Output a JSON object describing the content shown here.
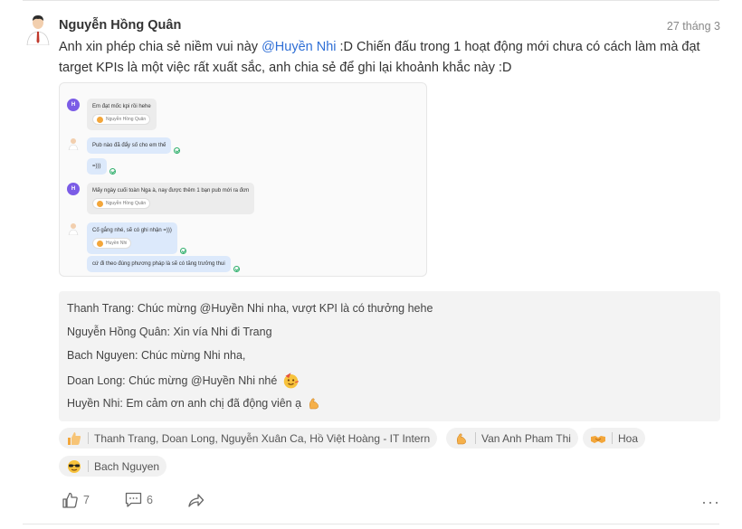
{
  "post": {
    "author": "Nguyễn Hồng Quân",
    "date": "27 tháng 3",
    "text_before": "Anh xin phép chia sẻ niềm vui này ",
    "mention": "@Huyền Nhi",
    "text_after": " :D Chiến đấu trong 1 hoạt động mới chưa có cách làm mà đạt target KPIs là một việc rất xuất sắc, anh chia sẻ để ghi lại khoảnh khắc này :D"
  },
  "screenshot": {
    "messages": [
      {
        "avatar": "H",
        "text": "Em đạt mốc kpi rồi hehe",
        "reaction": "Nguyễn Hồng Quân"
      },
      {
        "avatar": "man",
        "text": "Pub nào đã đẩy số cho em thế"
      },
      {
        "avatar": "",
        "text": "=)))"
      },
      {
        "avatar": "H",
        "text": "Mấy ngày cuối toàn Nga à, nay được thêm 1 bạn pub mới ra đơn",
        "reaction": "Nguyễn Hồng Quân"
      },
      {
        "avatar": "man",
        "text": "Cố gắng nhé, sẽ có ghi nhận =)))",
        "reaction": "Huyền Nhi"
      },
      {
        "avatar": "",
        "text": "cứ đi theo đúng phương pháp là sẽ có tăng trưởng thui"
      }
    ]
  },
  "comments": [
    {
      "name": "Thanh Trang:",
      "text": "Chúc mừng @Huyền Nhi nha, vượt KPI là có thưởng hehe",
      "emoji": ""
    },
    {
      "name": "Nguyễn Hồng Quân:",
      "text": "Xin vía Nhi đi Trang",
      "emoji": ""
    },
    {
      "name": "Bach Nguyen:",
      "text": "Chúc mừng Nhi nha,",
      "emoji": ""
    },
    {
      "name": "Doan Long:",
      "text": "Chúc mừng @Huyền Nhi nhé",
      "emoji": "party-face"
    },
    {
      "name": "Huyền Nhi:",
      "text": "Em cảm ơn anh chị đã động viên ạ",
      "emoji": "flexed-biceps"
    }
  ],
  "reactions": [
    {
      "icon": "thumbs-up",
      "names": [
        "Thanh Trang",
        "Doan Long",
        "Nguyễn Xuân Ca",
        "Hồ Việt Hoàng - IT Intern"
      ]
    },
    {
      "icon": "flexed-biceps",
      "names": [
        "Van Anh Pham Thi"
      ]
    },
    {
      "icon": "handshake",
      "names": [
        "Hoa"
      ]
    },
    {
      "icon": "sunglasses-face",
      "names": [
        "Bach Nguyen"
      ]
    }
  ],
  "actions": {
    "like_count": "7",
    "comment_count": "6",
    "more": "···"
  },
  "colors": {
    "mention": "#2f6fd6",
    "comment_bg": "#f3f3f3",
    "reaction_bg": "#f1f1f1"
  }
}
